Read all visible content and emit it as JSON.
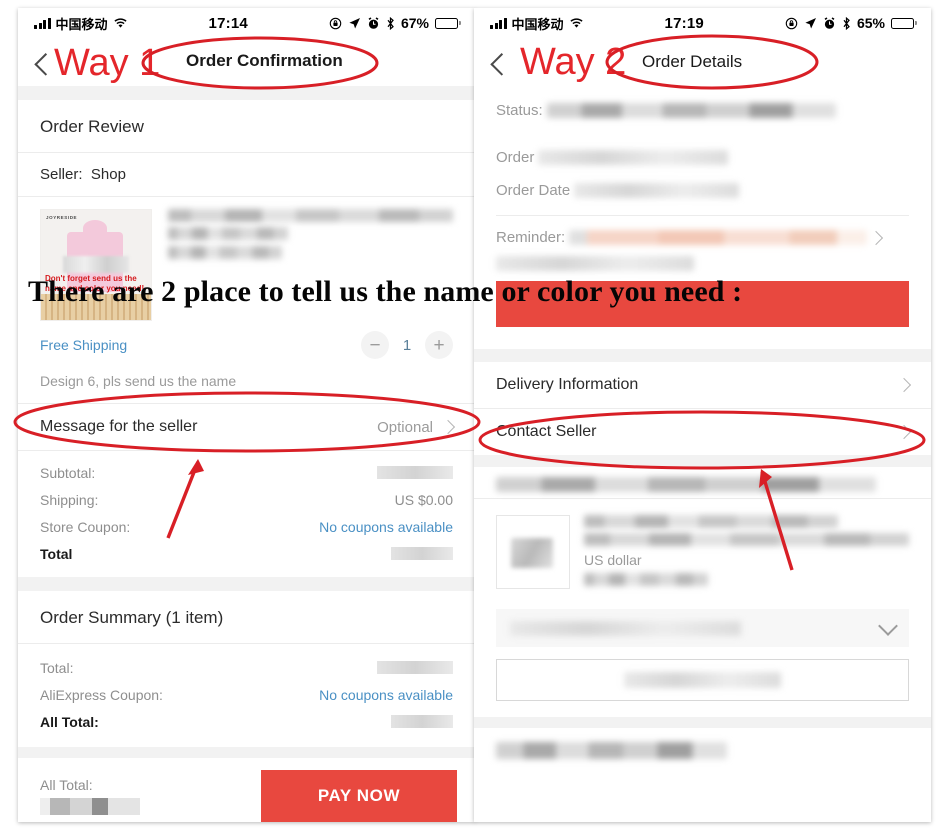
{
  "overlay": {
    "headline": "There are 2 place to tell us the name or color you need :"
  },
  "left_phone": {
    "status_bar": {
      "carrier": "中国移动",
      "time": "17:14",
      "battery_percent": "67%",
      "icons": [
        "signal-bars-icon",
        "wifi-icon",
        "rotation-lock-icon",
        "location-arrow-icon",
        "alarm-clock-icon",
        "bluetooth-icon",
        "battery-icon"
      ]
    },
    "nav": {
      "back_icon": "chevron-left-icon",
      "way_label": "Way 1",
      "title": "Order Confirmation"
    },
    "order_review": {
      "section_title": "Order Review",
      "seller_label": "Seller:",
      "seller_name": "Shop"
    },
    "product": {
      "image_brand": "JOYRESIDE",
      "image_note": "Don't forget send us the name and color you need!",
      "shipping_label": "Free Shipping",
      "qty_minus": "−",
      "qty_value": "1",
      "qty_plus": "+",
      "design_note": "Design 6, pls send us the name"
    },
    "message_row": {
      "label": "Message for the seller",
      "value": "Optional",
      "chevron": "chevron-right-icon"
    },
    "price_rows": [
      {
        "label": "Subtotal:",
        "value": "",
        "value_type": "blurred"
      },
      {
        "label": "Shipping:",
        "value": "US $0.00",
        "value_type": "text"
      },
      {
        "label": "Store Coupon:",
        "value": "No coupons available",
        "value_type": "link"
      },
      {
        "label": "Total",
        "value": "",
        "value_type": "blurred",
        "bold": true
      }
    ],
    "order_summary": {
      "title": "Order Summary (1 item)",
      "rows": [
        {
          "label": "Total:",
          "value": "",
          "value_type": "blurred"
        },
        {
          "label": "AliExpress Coupon:",
          "value": "No coupons available",
          "value_type": "link"
        },
        {
          "label": "All Total:",
          "value": "",
          "value_type": "blurred",
          "bold": true
        }
      ]
    },
    "pay_bar": {
      "all_total_label": "All Total:",
      "amount": "",
      "pay_button": "PAY NOW"
    }
  },
  "right_phone": {
    "status_bar": {
      "carrier": "中国移动",
      "time": "17:19",
      "battery_percent": "65%"
    },
    "nav": {
      "back_icon": "chevron-left-icon",
      "way_label": "Way 2",
      "title": "Order Details"
    },
    "detail_rows": [
      {
        "label": "Status:",
        "value": "",
        "value_type": "blurred"
      },
      {
        "label": "Order",
        "value": "",
        "value_type": "blurred"
      },
      {
        "label": "Order Date",
        "value": "",
        "value_type": "blurred"
      },
      {
        "label": "Reminder:",
        "value": "",
        "value_type": "blurred-pink"
      }
    ],
    "nav_rows": [
      {
        "label": "Delivery Information",
        "chevron": "chevron-right-icon"
      },
      {
        "label": "Contact Seller",
        "chevron": "chevron-right-icon"
      }
    ],
    "product": {
      "currency_note": "US dollar"
    },
    "select_row": {
      "chevron": "chevron-down-icon"
    }
  },
  "annotations": {
    "accent_red": "#d81f26",
    "banner_red": "#e8483f",
    "ellipses": [
      "order-confirmation-title",
      "message-for-the-seller-row",
      "order-details-title",
      "contact-seller-row"
    ],
    "arrows": [
      "arrow-to-message-row",
      "arrow-to-contact-seller"
    ]
  },
  "colors": {
    "link_blue": "#4a90c4",
    "way_red": "#e4262b",
    "page_background": "#ffffff"
  }
}
